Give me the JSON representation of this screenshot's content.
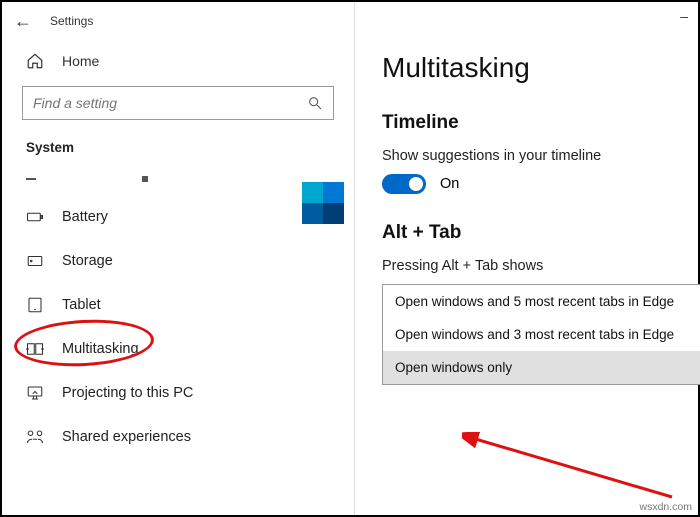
{
  "window": {
    "title": "Settings"
  },
  "sidebar": {
    "home": "Home",
    "search_placeholder": "Find a setting",
    "section": "System",
    "items": [
      {
        "label": "Battery"
      },
      {
        "label": "Storage"
      },
      {
        "label": "Tablet"
      },
      {
        "label": "Multitasking"
      },
      {
        "label": "Projecting to this PC"
      },
      {
        "label": "Shared experiences"
      }
    ]
  },
  "main": {
    "heading": "Multitasking",
    "timeline": {
      "title": "Timeline",
      "caption": "Show suggestions in your timeline",
      "toggle": "On"
    },
    "alttab": {
      "title": "Alt + Tab",
      "caption": "Pressing Alt + Tab shows",
      "options": [
        "Open windows and 5 most recent tabs in Edge",
        "Open windows and 3 most recent tabs in Edge",
        "Open windows only"
      ]
    }
  },
  "watermark": "wsxdn.com"
}
